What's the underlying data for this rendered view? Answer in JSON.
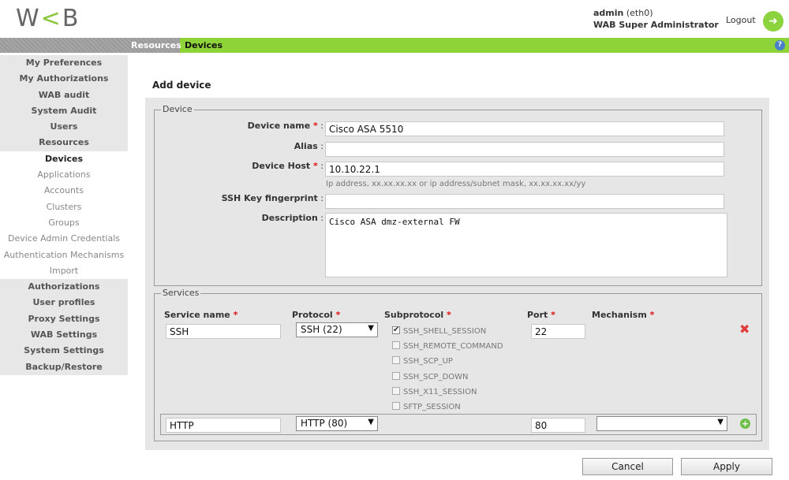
{
  "header": {
    "user": "admin",
    "interface": "(eth0)",
    "role": "WAB Super Administrator",
    "logout_label": "Logout"
  },
  "breadcrumb": {
    "parent": "Resources",
    "current": "Devices"
  },
  "sidebar": {
    "items": [
      {
        "label": "My Preferences"
      },
      {
        "label": "My Authorizations"
      },
      {
        "label": "WAB audit"
      },
      {
        "label": "System Audit"
      },
      {
        "label": "Users"
      },
      {
        "label": "Resources"
      },
      {
        "label": "Devices"
      },
      {
        "label": "Applications"
      },
      {
        "label": "Accounts"
      },
      {
        "label": "Clusters"
      },
      {
        "label": "Groups"
      },
      {
        "label": "Device Admin Credentials"
      },
      {
        "label": "Authentication Mechanisms"
      },
      {
        "label": "Import"
      },
      {
        "label": "Authorizations"
      },
      {
        "label": "User profiles"
      },
      {
        "label": "Proxy Settings"
      },
      {
        "label": "WAB Settings"
      },
      {
        "label": "System Settings"
      },
      {
        "label": "Backup/Restore"
      }
    ]
  },
  "page": {
    "title": "Add device"
  },
  "device": {
    "legend": "Device",
    "name_label": "Device name",
    "name_value": "Cisco ASA 5510",
    "alias_label": "Alias",
    "alias_value": "",
    "host_label": "Device Host",
    "host_value": "10.10.22.1",
    "host_hint": "Ip address, xx.xx.xx.xx or ip address/subnet mask, xx.xx.xx.xx/yy",
    "ssh_key_label": "SSH Key fingerprint",
    "ssh_key_value": "",
    "description_label": "Description",
    "description_value": "Cisco ASA dmz-external FW"
  },
  "services": {
    "legend": "Services",
    "col_service_name": "Service name",
    "col_protocol": "Protocol",
    "col_subprotocol": "Subprotocol",
    "col_port": "Port",
    "col_mechanism": "Mechanism",
    "rows": [
      {
        "service_name": "SSH",
        "protocol": "SSH (22)",
        "port": "22",
        "subprotocols": [
          {
            "label": "SSH_SHELL_SESSION",
            "checked": true
          },
          {
            "label": "SSH_REMOTE_COMMAND",
            "checked": false
          },
          {
            "label": "SSH_SCP_UP",
            "checked": false
          },
          {
            "label": "SSH_SCP_DOWN",
            "checked": false
          },
          {
            "label": "SSH_X11_SESSION",
            "checked": false
          },
          {
            "label": "SFTP_SESSION",
            "checked": false
          }
        ]
      },
      {
        "service_name": "HTTP",
        "protocol": "HTTP (80)",
        "port": "80",
        "mechanism": ""
      }
    ]
  },
  "buttons": {
    "cancel": "Cancel",
    "apply": "Apply"
  },
  "icons": {
    "logout": "logout-arrow-icon",
    "help": "help-icon",
    "delete": "delete-x-icon",
    "add": "add-plus-icon"
  },
  "colors": {
    "accent_green": "#8ed338",
    "required_red": "#d11111",
    "delete_red": "#e03c3c",
    "help_blue": "#4a7fc9"
  }
}
